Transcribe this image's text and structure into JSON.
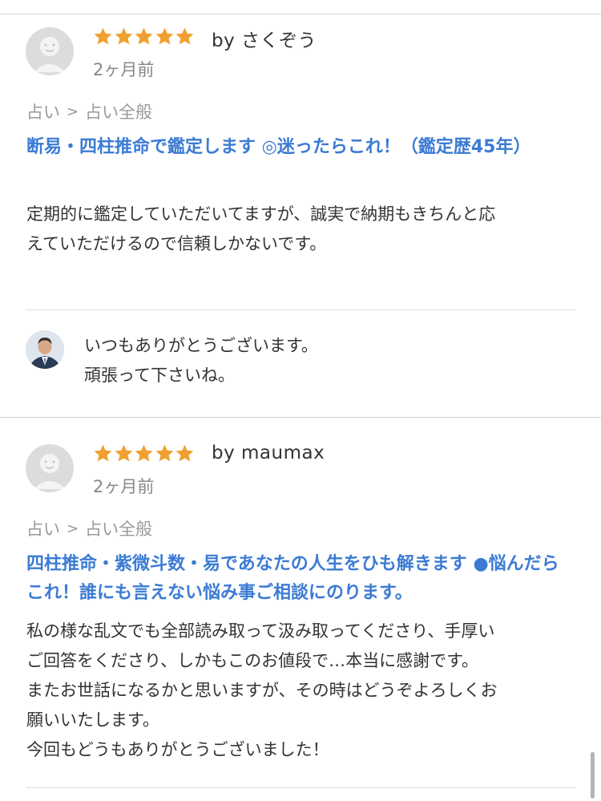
{
  "reviews": [
    {
      "rating": 5,
      "byline": "by さくぞう",
      "date": "2ヶ月前",
      "category": {
        "parent": "占い",
        "separator": ">",
        "child": "占い全般"
      },
      "service_title": "断易・四柱推命で鑑定します ◎迷ったらこれ！（鑑定歴45年）",
      "text_lines": [
        "定期的に鑑定していただいてますが、誠実で納期もきちんと応",
        "えていただけるので信頼しかないです。"
      ],
      "reply_lines": [
        "いつもありがとうございます。",
        "頑張って下さいね。"
      ]
    },
    {
      "rating": 5,
      "byline": "by maumax",
      "date": "2ヶ月前",
      "category": {
        "parent": "占い",
        "separator": ">",
        "child": "占い全般"
      },
      "service_title": "四柱推命・紫微斗数・易であなたの人生をひも解きます ●悩んだら これ！誰にも言えない悩み事ご相談にのります。",
      "text_lines": [
        "私の様な乱文でも全部読み取って汲み取ってくださり、手厚い",
        "ご回答をくださり、しかもこのお値段で…本当に感謝です。",
        "またお世話になるかと思いますが、その時はどうぞよろしくお",
        "願いいたします。",
        "今回もどうもありがとうございました！"
      ]
    }
  ],
  "colors": {
    "star": "#f0a030",
    "link": "#3b7bd4",
    "text": "#333333",
    "muted": "#888888"
  },
  "icons": {
    "avatar": "default-user-avatar-icon",
    "star": "star-icon",
    "reply_avatar": "seller-photo"
  }
}
